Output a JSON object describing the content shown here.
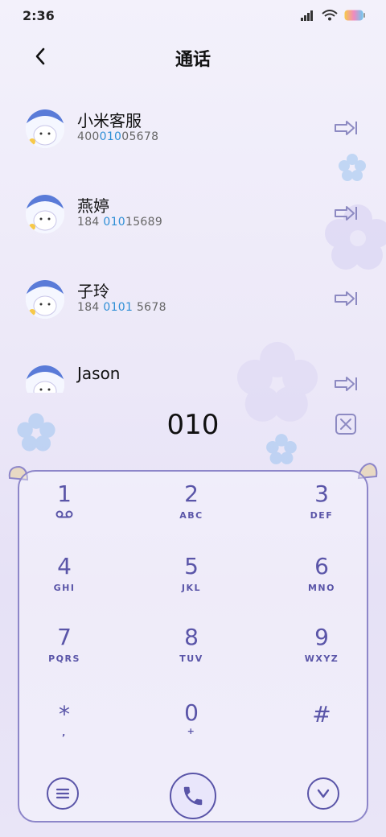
{
  "status_bar": {
    "time": "2:36"
  },
  "header": {
    "title": "通话"
  },
  "contacts": [
    {
      "name": "小米客服",
      "number_parts": [
        "400",
        "010",
        "05678"
      ]
    },
    {
      "name": "燕婷",
      "number_parts": [
        "184 ",
        "010",
        "15689"
      ]
    },
    {
      "name": "子玲",
      "number_parts": [
        "184 ",
        "0101",
        " 5678"
      ]
    },
    {
      "name": "Jason",
      "number_parts": [
        "",
        "",
        ""
      ]
    }
  ],
  "dialer": {
    "number": "010"
  },
  "keypad": {
    "keys": [
      {
        "digit": "1",
        "letters": ""
      },
      {
        "digit": "2",
        "letters": "ABC"
      },
      {
        "digit": "3",
        "letters": "DEF"
      },
      {
        "digit": "4",
        "letters": "GHI"
      },
      {
        "digit": "5",
        "letters": "JKL"
      },
      {
        "digit": "6",
        "letters": "MNO"
      },
      {
        "digit": "7",
        "letters": "PQRS"
      },
      {
        "digit": "8",
        "letters": "TUV"
      },
      {
        "digit": "9",
        "letters": "WXYZ"
      },
      {
        "digit": "*",
        "letters": ","
      },
      {
        "digit": "0",
        "letters": "+"
      },
      {
        "digit": "#",
        "letters": ""
      }
    ]
  },
  "colors": {
    "accent": "#5a55a8",
    "highlight": "#2e8fd6"
  }
}
